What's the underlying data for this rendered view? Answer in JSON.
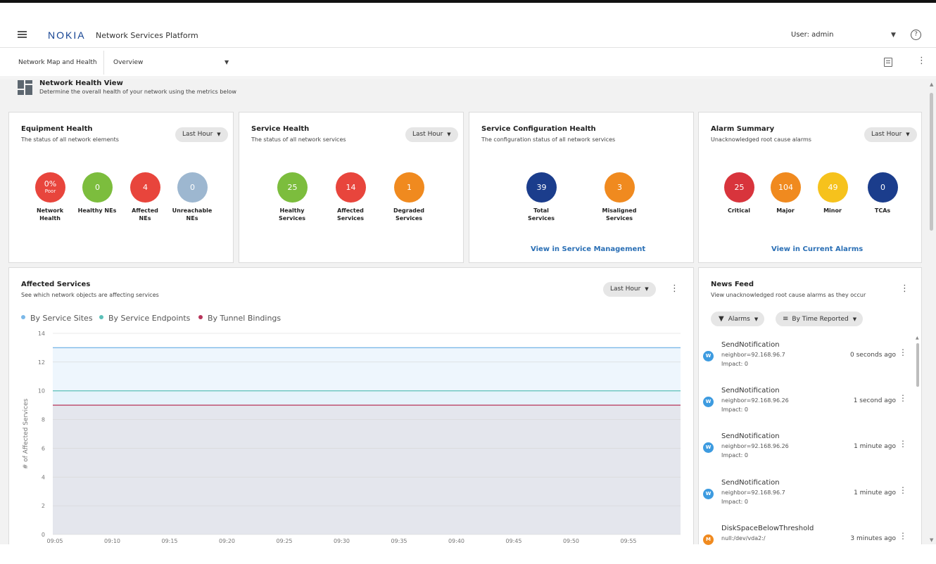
{
  "header": {
    "logo": "NOKIA",
    "app_title": "Network Services Platform",
    "user": "User: admin",
    "help": "?"
  },
  "subbar": {
    "breadcrumb": "Network Map and Health",
    "view_selected": "Overview"
  },
  "page": {
    "title": "Network Health View",
    "subtitle": "Determine the overall health of your network using the metrics below"
  },
  "equipment": {
    "title": "Equipment Health",
    "subtitle": "The status of all network elements",
    "filter": "Last Hour",
    "metrics": [
      {
        "value": "0%",
        "sub": "Poor",
        "label1": "Network",
        "label2": "Health",
        "color": "#e8453c"
      },
      {
        "value": "0",
        "label1": "Healthy NEs",
        "label2": "",
        "color": "#7cbd3d"
      },
      {
        "value": "4",
        "label1": "Affected",
        "label2": "NEs",
        "color": "#e8453c"
      },
      {
        "value": "0",
        "label1": "Unreachable",
        "label2": "NEs",
        "color": "#9db7d0"
      }
    ]
  },
  "service": {
    "title": "Service Health",
    "subtitle": "The status of all network services",
    "filter": "Last Hour",
    "metrics": [
      {
        "value": "25",
        "label1": "Healthy",
        "label2": "Services",
        "color": "#7cbd3d"
      },
      {
        "value": "14",
        "label1": "Affected",
        "label2": "Services",
        "color": "#e8453c"
      },
      {
        "value": "1",
        "label1": "Degraded",
        "label2": "Services",
        "color": "#f08a1f"
      }
    ]
  },
  "config": {
    "title": "Service Configuration Health",
    "subtitle": "The configuration status of all network services",
    "metrics": [
      {
        "value": "39",
        "label1": "Total",
        "label2": "Services",
        "color": "#1b3d8c"
      },
      {
        "value": "3",
        "label1": "Misaligned",
        "label2": "Services",
        "color": "#f08a1f"
      }
    ],
    "link": "View in Service Management"
  },
  "alarms": {
    "title": "Alarm Summary",
    "subtitle": "Unacknowledged root cause alarms",
    "filter": "Last Hour",
    "metrics": [
      {
        "value": "25",
        "label1": "Critical",
        "color": "#d8343c"
      },
      {
        "value": "104",
        "label1": "Major",
        "color": "#f08a1f"
      },
      {
        "value": "49",
        "label1": "Minor",
        "color": "#f6c21c"
      },
      {
        "value": "0",
        "label1": "TCAs",
        "color": "#1b3d8c"
      }
    ],
    "link": "View in Current Alarms"
  },
  "affected": {
    "title": "Affected Services",
    "subtitle": "See which network objects are affecting services",
    "filter": "Last Hour",
    "legend": [
      {
        "label": "By Service Sites",
        "color": "#7cb8e8"
      },
      {
        "label": "By Service Endpoints",
        "color": "#5bc0b8"
      },
      {
        "label": "By Tunnel Bindings",
        "color": "#b8345a"
      }
    ]
  },
  "news": {
    "title": "News Feed",
    "subtitle": "View unacknowledged root cause alarms as they occur",
    "filter_label": "Alarms",
    "sort_label": "By Time Reported",
    "items": [
      {
        "badge": "W",
        "badge_color": "#3d9be0",
        "title": "SendNotification",
        "detail": "neighbor=92.168.96.7",
        "impact": "Impact: 0",
        "time": "0 seconds ago"
      },
      {
        "badge": "W",
        "badge_color": "#3d9be0",
        "title": "SendNotification",
        "detail": "neighbor=92.168.96.26",
        "impact": "Impact: 0",
        "time": "1 second ago"
      },
      {
        "badge": "W",
        "badge_color": "#3d9be0",
        "title": "SendNotification",
        "detail": "neighbor=92.168.96.26",
        "impact": "Impact: 0",
        "time": "1 minute ago"
      },
      {
        "badge": "W",
        "badge_color": "#3d9be0",
        "title": "SendNotification",
        "detail": "neighbor=92.168.96.7",
        "impact": "Impact: 0",
        "time": "1 minute ago"
      },
      {
        "badge": "M",
        "badge_color": "#f08a1f",
        "title": "DiskSpaceBelowThreshold",
        "detail": "null:/dev/vda2:/",
        "impact": "",
        "time": "3 minutes ago"
      }
    ]
  },
  "chart_data": {
    "type": "area",
    "title": "",
    "xlabel": "",
    "ylabel": "# of Affected Services",
    "ylim": [
      0,
      14
    ],
    "yticks": [
      0,
      2,
      4,
      6,
      8,
      10,
      12,
      14
    ],
    "xticks": [
      "09:05",
      "09:10",
      "09:15",
      "09:20",
      "09:25",
      "09:30",
      "09:35",
      "09:40",
      "09:45",
      "09:50",
      "09:55"
    ],
    "grid": true,
    "legend_position": "top-left",
    "series": [
      {
        "name": "By Service Sites",
        "value": 13,
        "color": "#7cb8e8",
        "fill": "#eef6fd"
      },
      {
        "name": "By Service Endpoints",
        "value": 10,
        "color": "#5bc0b8",
        "fill": "#e6f3fb"
      },
      {
        "name": "By Tunnel Bindings",
        "value": 9,
        "color": "#b8345a",
        "fill": "#e4e6ed"
      }
    ]
  }
}
